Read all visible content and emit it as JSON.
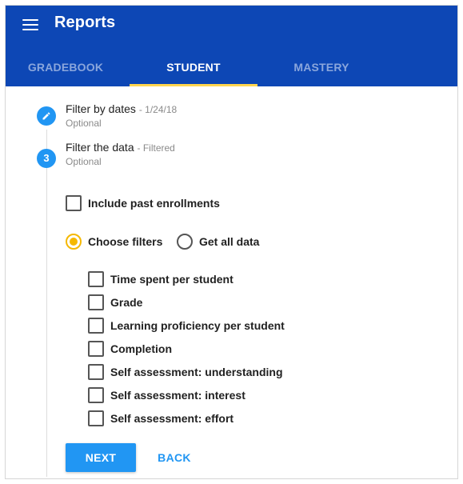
{
  "app": {
    "title": "Reports"
  },
  "tabs": [
    {
      "label": "GRADEBOOK",
      "active": false
    },
    {
      "label": "STUDENT",
      "active": true
    },
    {
      "label": "MASTERY",
      "active": false
    }
  ],
  "steps": [
    {
      "title": "Filter by dates",
      "meta": "- 1/24/18",
      "subtitle": "Optional",
      "icon": "pencil-icon"
    },
    {
      "number": "3",
      "title": "Filter the data",
      "meta": "- Filtered",
      "subtitle": "Optional"
    }
  ],
  "include_past_enrollments": {
    "label": "Include past enrollments",
    "checked": false
  },
  "filter_mode": {
    "options": [
      {
        "label": "Choose filters",
        "selected": true
      },
      {
        "label": "Get all data",
        "selected": false
      }
    ]
  },
  "filters": [
    {
      "label": "Time spent per student",
      "checked": false
    },
    {
      "label": "Grade",
      "checked": false
    },
    {
      "label": "Learning proficiency per student",
      "checked": false
    },
    {
      "label": "Completion",
      "checked": false
    },
    {
      "label": "Self assessment: understanding",
      "checked": false
    },
    {
      "label": "Self assessment: interest",
      "checked": false
    },
    {
      "label": "Self assessment: effort",
      "checked": false
    }
  ],
  "actions": {
    "next_label": "NEXT",
    "back_label": "BACK"
  },
  "colors": {
    "app_bar": "#0d47b5",
    "tab_indicator": "#ffd54f",
    "primary": "#2196f3",
    "radio_selected": "#f5b800"
  }
}
